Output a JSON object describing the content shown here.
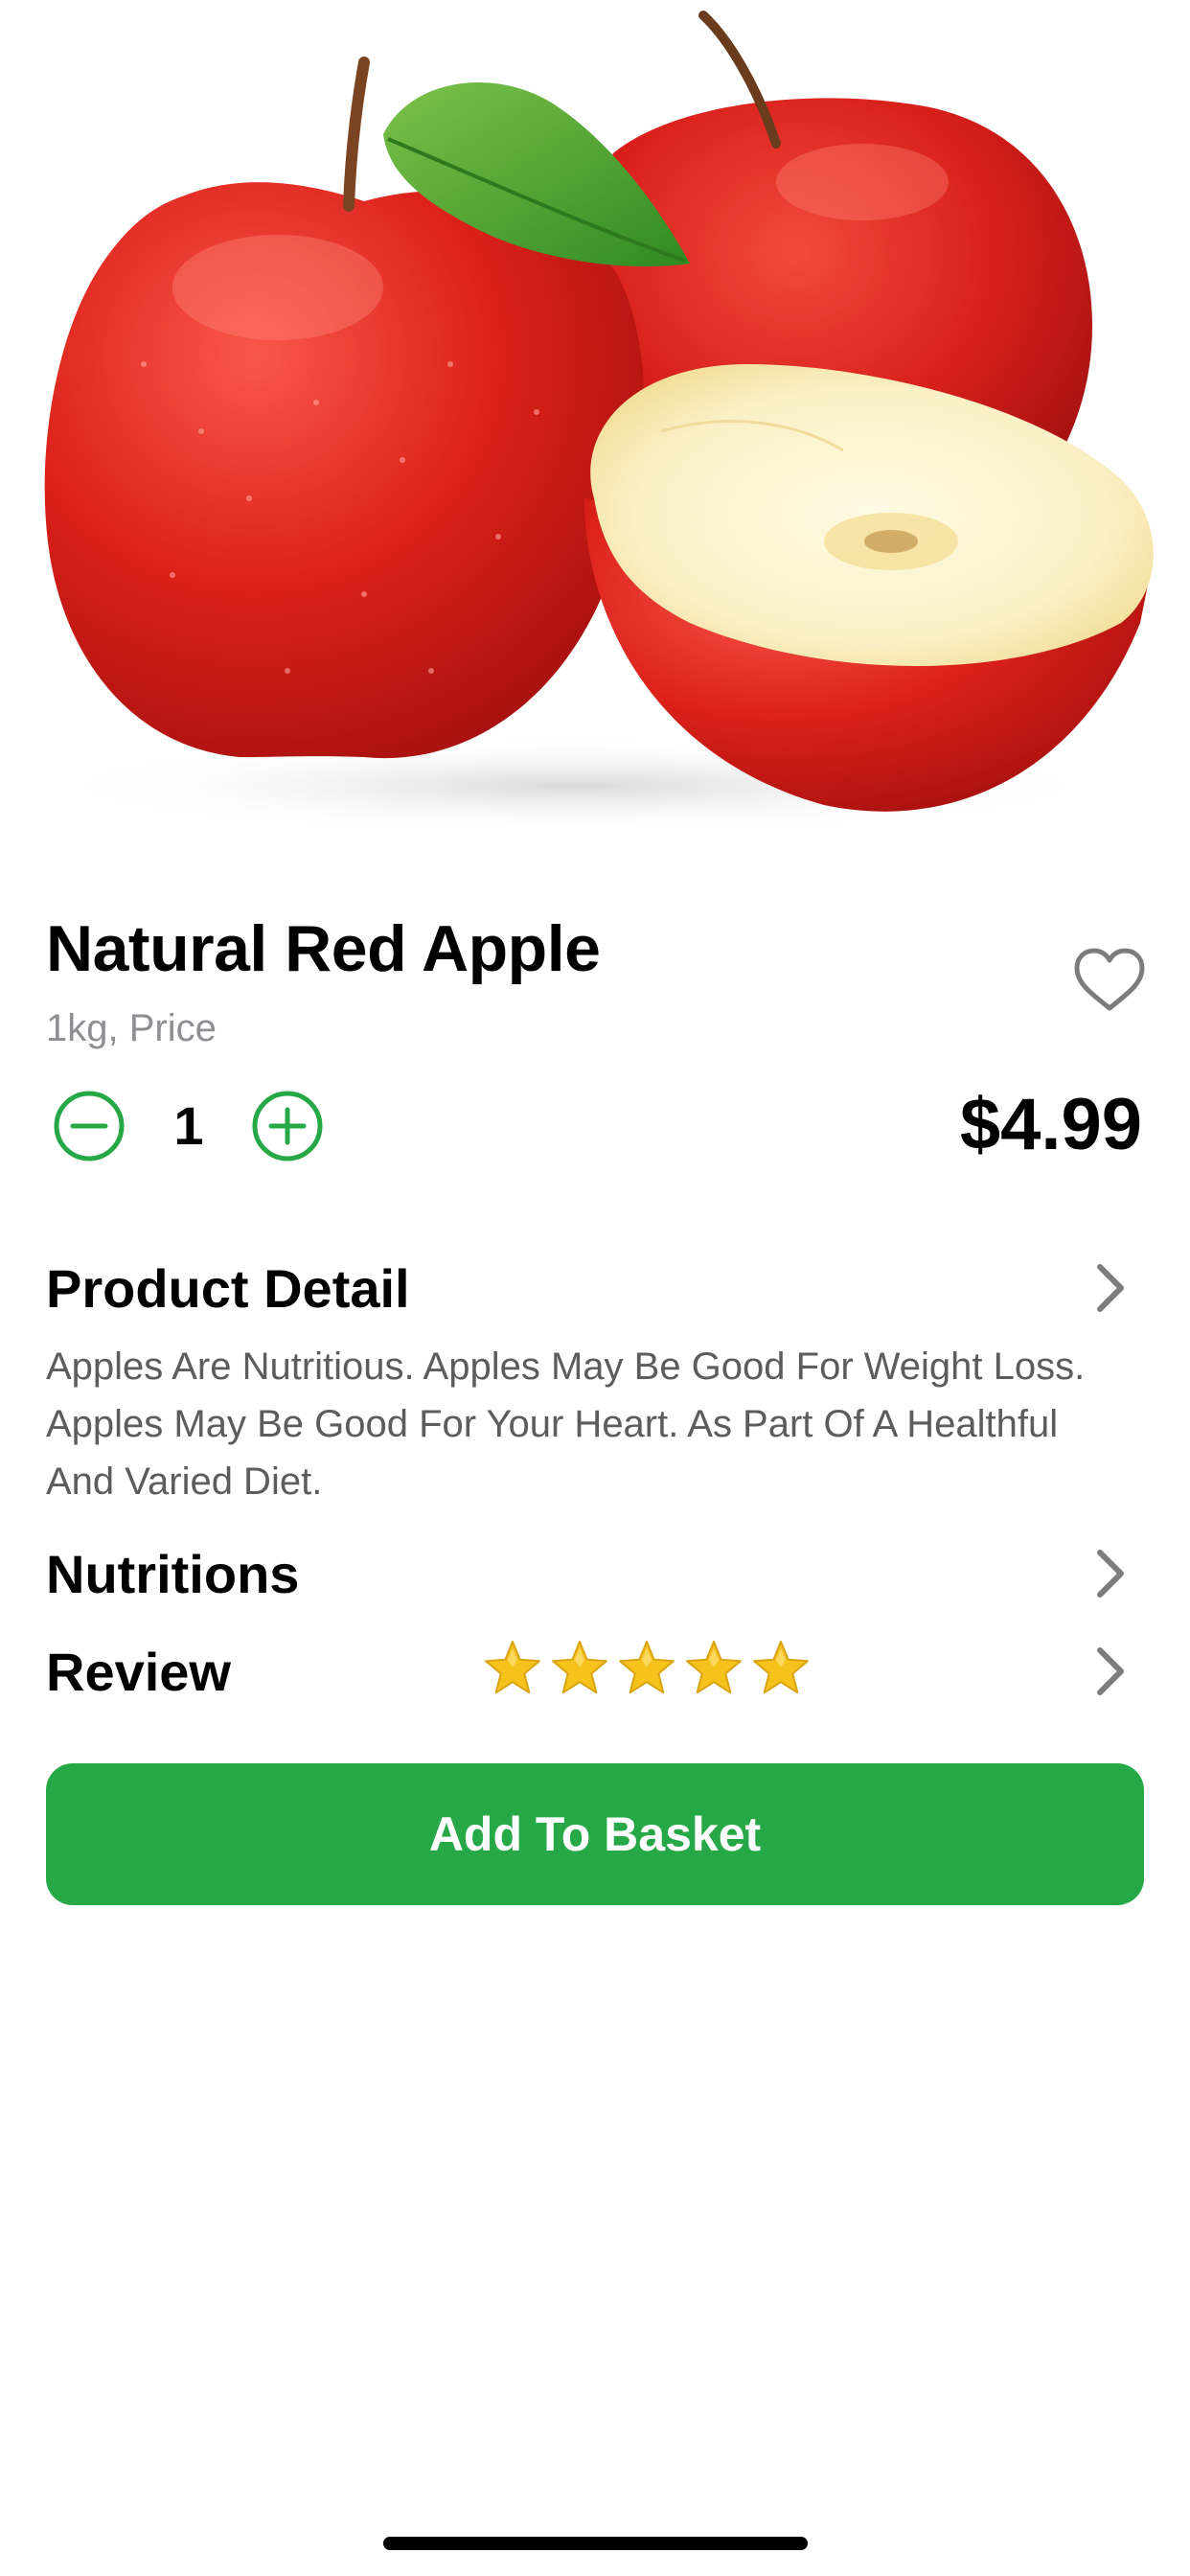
{
  "product": {
    "image_icon": "red-apples-image",
    "title": "Natural Red Apple",
    "subtitle": "1kg, Price",
    "favorite_icon": "heart-outline-icon",
    "price": "$4.99"
  },
  "quantity": {
    "minus_icon": "minus-circle-icon",
    "value": "1",
    "plus_icon": "plus-circle-icon"
  },
  "sections": {
    "detail": {
      "title": "Product Detail",
      "body": "Apples Are Nutritious. Apples May Be Good For Weight Loss. Apples May Be Good For Your Heart. As Part Of A Healthful And Varied Diet.",
      "chevron_icon": "chevron-right-icon"
    },
    "nutritions": {
      "title": "Nutritions",
      "chevron_icon": "chevron-right-icon"
    },
    "review": {
      "title": "Review",
      "rating": 5,
      "rating_max": 5,
      "chevron_icon": "chevron-right-icon"
    }
  },
  "cta": {
    "label": "Add To Basket"
  },
  "colors": {
    "accent": "#27a847",
    "muted_text": "#8e8e93",
    "body_text": "#5c5c5c",
    "star": "#f6c21b"
  }
}
